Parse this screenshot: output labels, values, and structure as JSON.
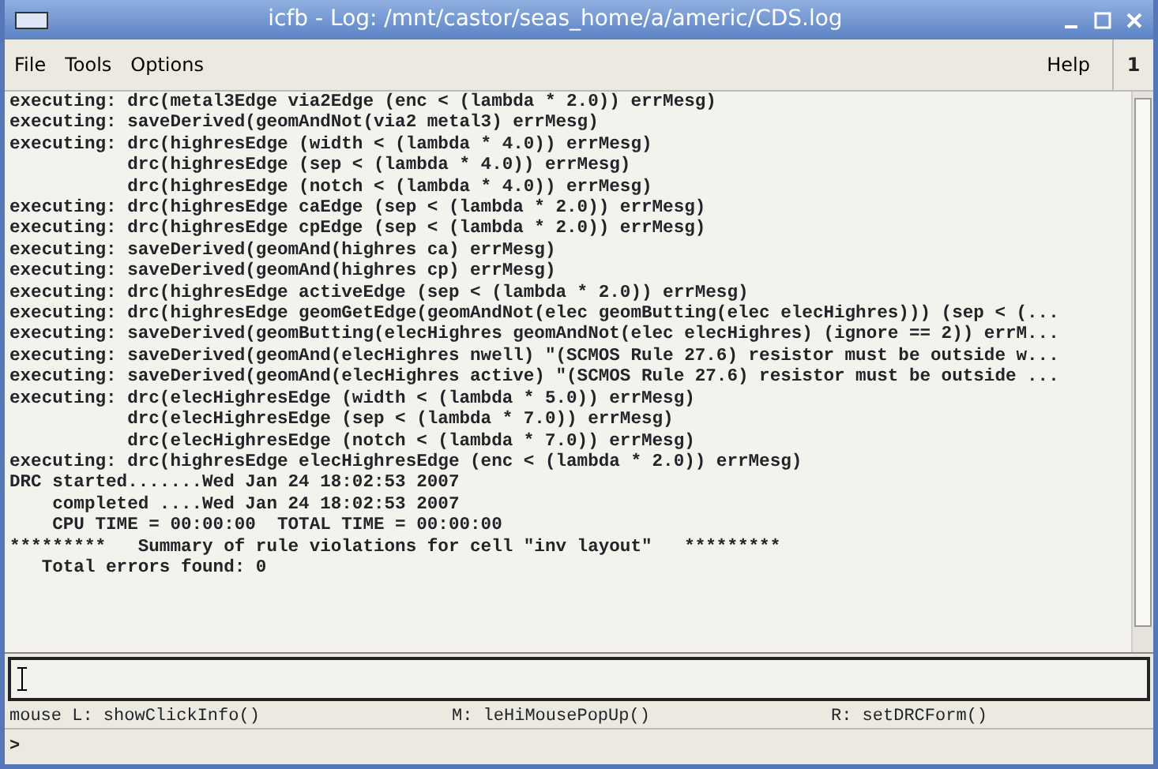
{
  "window": {
    "title": "icfb - Log: /mnt/castor/seas_home/a/americ/CDS.log"
  },
  "menu": {
    "items": [
      "File",
      "Tools",
      "Options"
    ],
    "help": "Help",
    "number": "1"
  },
  "log": {
    "lines": [
      "executing: drc(metal3Edge via2Edge (enc < (lambda * 2.0)) errMesg)",
      "executing: saveDerived(geomAndNot(via2 metal3) errMesg)",
      "executing: drc(highresEdge (width < (lambda * 4.0)) errMesg)",
      "           drc(highresEdge (sep < (lambda * 4.0)) errMesg)",
      "           drc(highresEdge (notch < (lambda * 4.0)) errMesg)",
      "executing: drc(highresEdge caEdge (sep < (lambda * 2.0)) errMesg)",
      "executing: drc(highresEdge cpEdge (sep < (lambda * 2.0)) errMesg)",
      "executing: saveDerived(geomAnd(highres ca) errMesg)",
      "executing: saveDerived(geomAnd(highres cp) errMesg)",
      "executing: drc(highresEdge activeEdge (sep < (lambda * 2.0)) errMesg)",
      "executing: drc(highresEdge geomGetEdge(geomAndNot(elec geomButting(elec elecHighres))) (sep < (...",
      "executing: saveDerived(geomButting(elecHighres geomAndNot(elec elecHighres) (ignore == 2)) errM...",
      "executing: saveDerived(geomAnd(elecHighres nwell) \"(SCMOS Rule 27.6) resistor must be outside w...",
      "executing: saveDerived(geomAnd(elecHighres active) \"(SCMOS Rule 27.6) resistor must be outside ...",
      "executing: drc(elecHighresEdge (width < (lambda * 5.0)) errMesg)",
      "           drc(elecHighresEdge (sep < (lambda * 7.0)) errMesg)",
      "           drc(elecHighresEdge (notch < (lambda * 7.0)) errMesg)",
      "executing: drc(highresEdge elecHighresEdge (enc < (lambda * 2.0)) errMesg)",
      "DRC started.......Wed Jan 24 18:02:53 2007",
      "    completed ....Wed Jan 24 18:02:53 2007",
      "    CPU TIME = 00:00:00  TOTAL TIME = 00:00:00",
      "*********   Summary of rule violations for cell \"inv layout\"   *********",
      "   Total errors found: 0"
    ]
  },
  "status": [
    "mouse L: showClickInfo()",
    "M: leHiMousePopUp()",
    "R: setDRCForm()"
  ],
  "prompt": ">"
}
